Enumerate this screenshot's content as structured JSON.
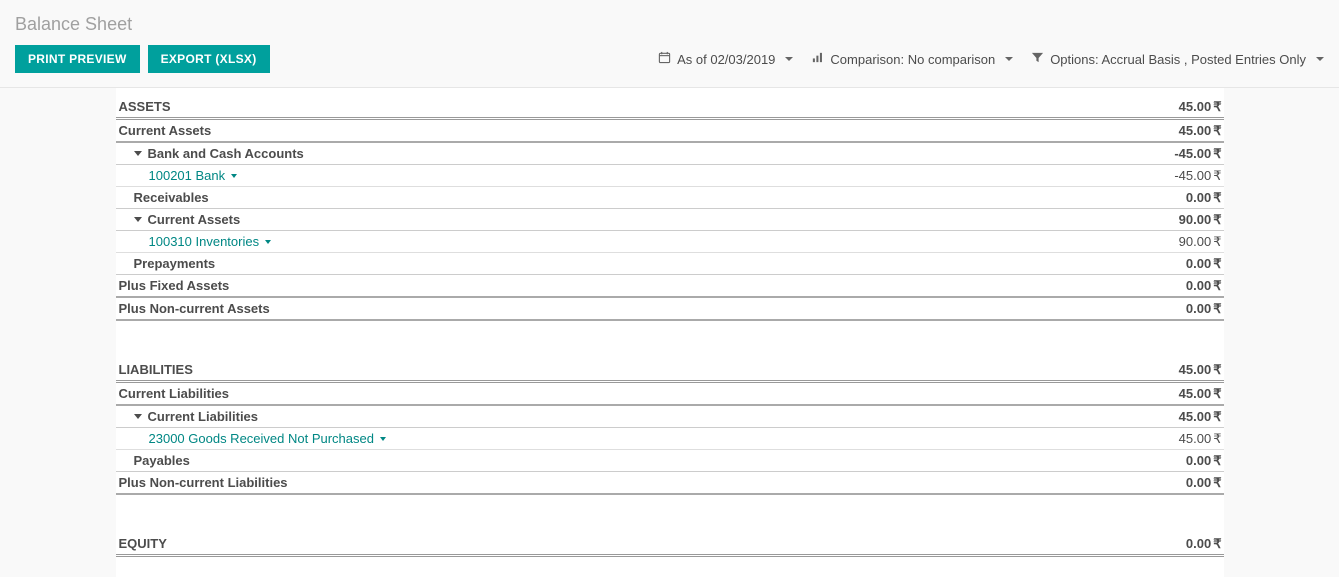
{
  "title": "Balance Sheet",
  "buttons": {
    "print": "PRINT PREVIEW",
    "export": "EXPORT (XLSX)"
  },
  "controls": {
    "date_prefix": "As of",
    "date": "02/03/2019",
    "comparison_label": "Comparison:",
    "comparison_value": "No comparison",
    "options_label": "Options:",
    "options_value": "Accrual Basis , Posted Entries Only"
  },
  "currency": "₹",
  "sections": {
    "assets": {
      "heading": "ASSETS",
      "value": "45.00",
      "current_assets": {
        "label": "Current Assets",
        "value": "45.00"
      },
      "bank_cash": {
        "label": "Bank and Cash Accounts",
        "value": "-45.00"
      },
      "bank_item": {
        "label": "100201 Bank",
        "value": "-45.00"
      },
      "receivables": {
        "label": "Receivables",
        "value": "0.00"
      },
      "ca_sub": {
        "label": "Current Assets",
        "value": "90.00"
      },
      "inventories": {
        "label": "100310 Inventories",
        "value": "90.00"
      },
      "prepayments": {
        "label": "Prepayments",
        "value": "0.00"
      },
      "fixed": {
        "label": "Plus Fixed Assets",
        "value": "0.00"
      },
      "noncurrent": {
        "label": "Plus Non-current Assets",
        "value": "0.00"
      }
    },
    "liabilities": {
      "heading": "LIABILITIES",
      "value": "45.00",
      "current": {
        "label": "Current Liabilities",
        "value": "45.00"
      },
      "current_sub": {
        "label": "Current Liabilities",
        "value": "45.00"
      },
      "goods": {
        "label": "23000 Goods Received Not Purchased",
        "value": "45.00"
      },
      "payables": {
        "label": "Payables",
        "value": "0.00"
      },
      "noncurrent": {
        "label": "Plus Non-current Liabilities",
        "value": "0.00"
      }
    },
    "equity": {
      "heading": "EQUITY",
      "value": "0.00"
    }
  }
}
